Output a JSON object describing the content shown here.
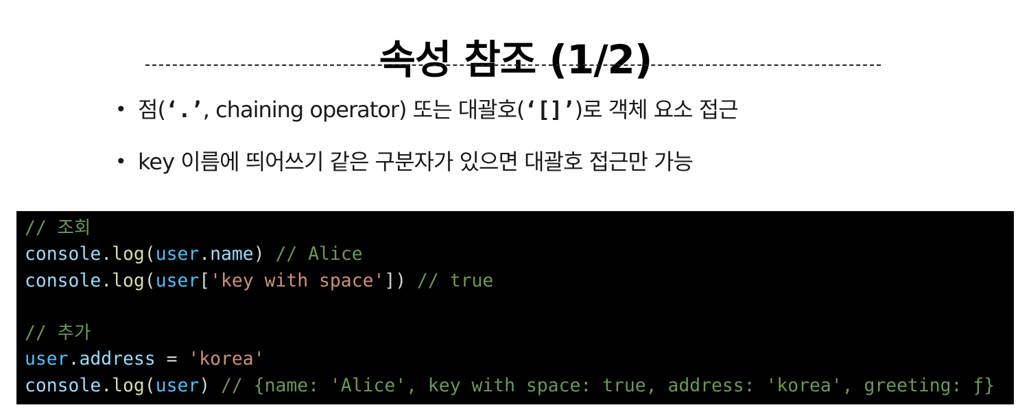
{
  "slide": {
    "title": "속성 참조 (1/2)"
  },
  "bullets": [
    {
      "prefix": "점(",
      "mono": "‘.’",
      "middle": ", chaining operator) 또는 대괄호(",
      "mono2": "‘[]’",
      "suffix": ")로 객체 요소 접근"
    },
    {
      "text": "key 이름에 띄어쓰기 같은 구분자가 있으면 대괄호 접근만 가능"
    }
  ],
  "code": {
    "line1": {
      "comment": "// 조회"
    },
    "line2": {
      "obj": "console",
      "dot": ".",
      "func": "log",
      "open": "(",
      "var": "user",
      "dot2": ".",
      "prop": "name",
      "close": ")",
      "comment": " // Alice"
    },
    "line3": {
      "obj": "console",
      "dot": ".",
      "func": "log",
      "open": "(",
      "var": "user",
      "bracket_open": "[",
      "str": "'key with space'",
      "bracket_close": "]",
      "close": ")",
      "comment": " // true"
    },
    "line4": {
      "text": ""
    },
    "line5": {
      "comment": "// 추가"
    },
    "line6": {
      "var": "user",
      "dot": ".",
      "prop": "address",
      "op": " = ",
      "str": "'korea'"
    },
    "line7": {
      "obj": "console",
      "dot": ".",
      "func": "log",
      "open": "(",
      "var": "user",
      "close": ")",
      "comment": " // {name: 'Alice', key with space: true, address: 'korea', greeting: ƒ}"
    }
  },
  "colors": {
    "code_background": "#000000",
    "comment": "#6a9955",
    "function": "#dcdcaa",
    "variable": "#4fc1ff",
    "object": "#9cdcfe",
    "string": "#ce9178",
    "text": "#d4d4d4"
  }
}
